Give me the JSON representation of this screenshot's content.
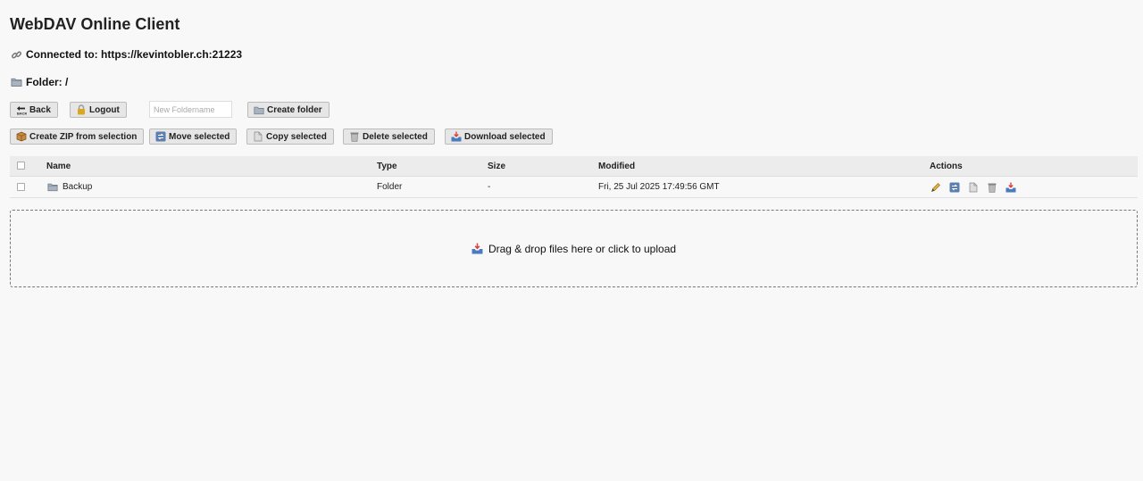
{
  "app": {
    "title": "WebDAV Online Client",
    "connected_label": "Connected to: https://kevintobler.ch:21223",
    "folder_label": "Folder: /"
  },
  "toolbar": {
    "back_label": "Back",
    "logout_label": "Logout",
    "new_folder_placeholder": "New Foldername",
    "new_folder_value": "",
    "create_folder_label": "Create folder",
    "zip_label": "Create ZIP from selection",
    "move_label": "Move selected",
    "copy_label": "Copy selected",
    "delete_label": "Delete selected",
    "download_label": "Download selected"
  },
  "table": {
    "columns": [
      "Name",
      "Type",
      "Size",
      "Modified",
      "Actions"
    ],
    "rows": [
      {
        "name": "Backup",
        "type": "Folder",
        "size": "-",
        "modified": "Fri, 25 Jul 2025 17:49:56 GMT",
        "icon": "folder-icon"
      }
    ],
    "row_actions": [
      "pencil-icon",
      "move-icon",
      "copy-icon",
      "trash-icon",
      "download-icon"
    ]
  },
  "dropzone": {
    "label": "Drag & drop files here or click to upload",
    "icon": "inbox-tray-icon"
  },
  "icons": {
    "connected": "link-icon",
    "folder": "folder-icon",
    "back": "back-arrow-icon",
    "logout": "lock-icon",
    "create_folder": "folder-icon",
    "zip": "package-icon",
    "move": "move-icon",
    "copy": "copy-icon",
    "delete": "trash-icon",
    "download": "download-icon"
  },
  "colors": {
    "background": "#f8f8f8",
    "button_bg": "#e6e6e6",
    "header_bg": "#ececec",
    "folder_icon": "#8a97a6",
    "lock_icon": "#d9a81f",
    "download_icon": "#d9443a"
  }
}
